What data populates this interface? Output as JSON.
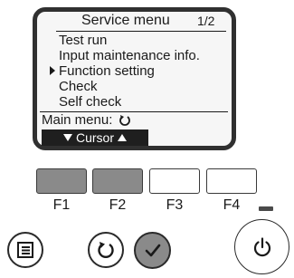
{
  "screen": {
    "title": "Service menu",
    "page": "1/2",
    "items": [
      "Test run",
      "Input maintenance info.",
      "Function setting",
      "Check",
      "Self check"
    ],
    "selected_index": 2,
    "main_menu_label": "Main menu:",
    "softkey_label": "Cursor"
  },
  "keys": {
    "labels": [
      "F1",
      "F2",
      "F3",
      "F4"
    ]
  },
  "colors": {
    "display_border": "#303030",
    "display_bg": "#f6f6f6",
    "pressed_key": "#8a8a8a",
    "softkey_bar": "#1f1f1f"
  },
  "icons": {
    "menu_button": "menu-icon",
    "return_button": "return-icon",
    "ok_button": "check-icon",
    "power_button": "power-icon"
  }
}
